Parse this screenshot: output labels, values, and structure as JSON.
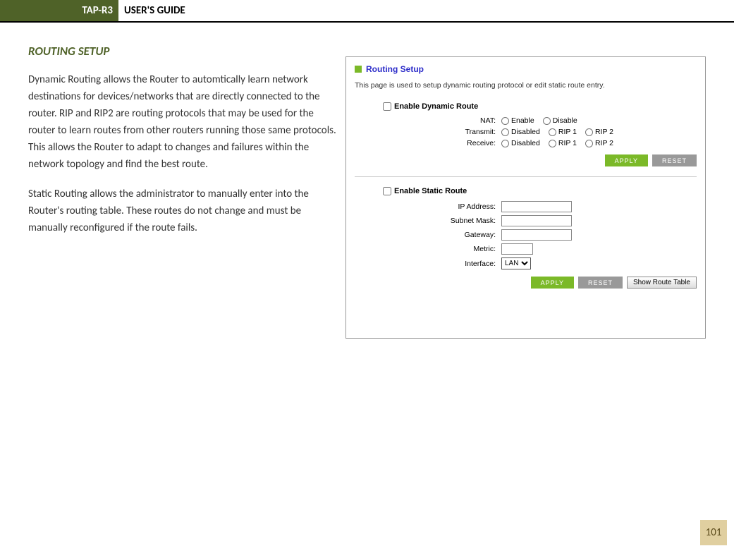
{
  "header": {
    "product": "TAP-R3",
    "title": "USER'S GUIDE"
  },
  "section_title": "ROUTING SETUP",
  "para1": "Dynamic Routing allows the Router to automtically learn network destinations for devices/networks that are directly connected to the router. RIP and RIP2 are routing protocols that may be used for the router to learn routes from other routers running those same protocols. This allows the Router to adapt to changes and failures within the network topology and find the best route.",
  "para2": "Static Routing allows the administrator to manually enter into the Router's routing table. These routes do not change and must be manually reconfigured if the route fails.",
  "panel": {
    "title": "Routing Setup",
    "desc": "This page is used to setup dynamic routing protocol or edit static route entry.",
    "dynamic": {
      "checkbox": "Enable Dynamic Route",
      "nat_label": "NAT:",
      "nat_opts": [
        "Enable",
        "Disable"
      ],
      "transmit_label": "Transmit:",
      "transmit_opts": [
        "Disabled",
        "RIP 1",
        "RIP 2"
      ],
      "receive_label": "Receive:",
      "receive_opts": [
        "Disabled",
        "RIP 1",
        "RIP 2"
      ]
    },
    "static": {
      "checkbox": "Enable Static Route",
      "ip_label": "IP Address:",
      "subnet_label": "Subnet Mask:",
      "gateway_label": "Gateway:",
      "metric_label": "Metric:",
      "interface_label": "Interface:",
      "interface_value": "LAN"
    },
    "buttons": {
      "apply": "APPLY",
      "reset": "RESET",
      "show": "Show Route Table"
    }
  },
  "page_number": "101"
}
